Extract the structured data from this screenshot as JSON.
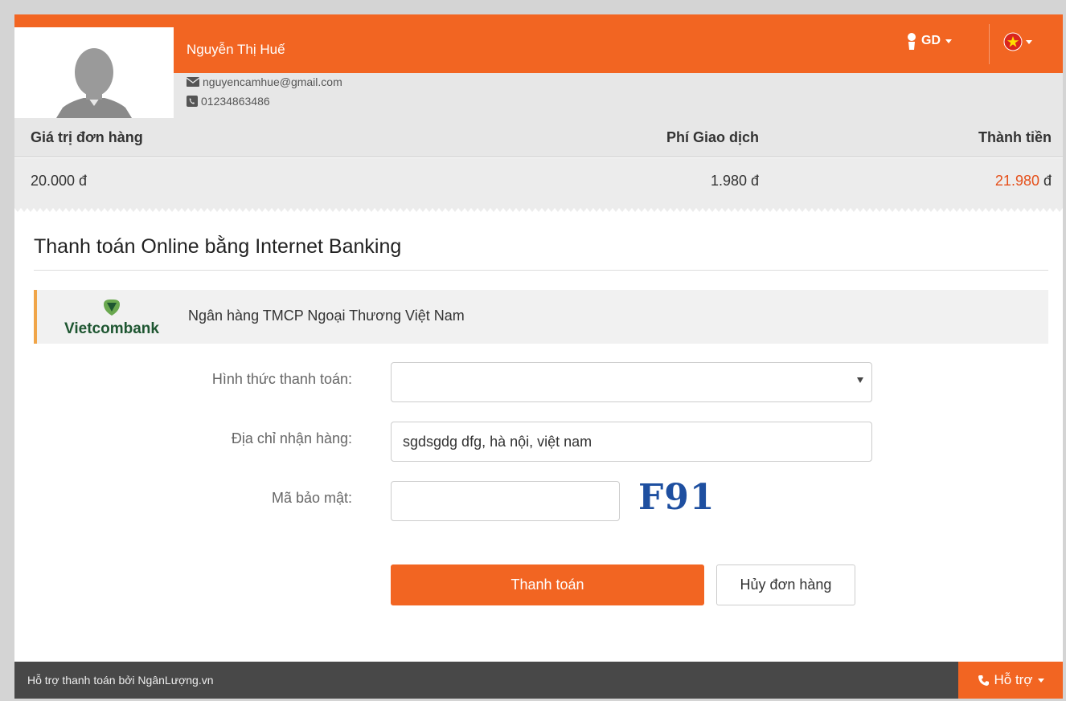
{
  "user": {
    "name": "Nguyễn Thị Huế",
    "email": "nguyencamhue@gmail.com",
    "phone": "01234863486"
  },
  "nav": {
    "role_label": "GD",
    "language": "vietnam-flag-icon"
  },
  "summary": {
    "headers": {
      "order_value": "Giá trị đơn hàng",
      "fee": "Phí Giao dịch",
      "total": "Thành tiền"
    },
    "values": {
      "order_value": "20.000 đ",
      "fee": "1.980 đ",
      "total_amount": "21.980",
      "total_currency": " đ"
    }
  },
  "section": {
    "title": "Thanh toán Online bằng Internet Banking"
  },
  "bank": {
    "logo_text": "Vietcombank",
    "name": "Ngân hàng TMCP Ngoại Thương Việt Nam"
  },
  "form": {
    "method_label": "Hình thức thanh toán:",
    "method_value": "",
    "address_label": "Địa chỉ nhận hàng:",
    "address_value": "sgdsgdg dfg, hà nội, việt nam",
    "captcha_label": "Mã bảo mật:",
    "captcha_value": "",
    "captcha_text": "F91",
    "pay_label": "Thanh toán",
    "cancel_label": "Hủy đơn hàng"
  },
  "footer": {
    "text": "Hỗ trợ thanh toán bởi NgânLượng.vn",
    "support_label": "Hỗ trợ"
  },
  "colors": {
    "accent": "#f26522",
    "total_highlight": "#e5501b",
    "bank_accent": "#f0a548",
    "footer_bg": "#484848",
    "captcha": "#1e4fa0"
  }
}
